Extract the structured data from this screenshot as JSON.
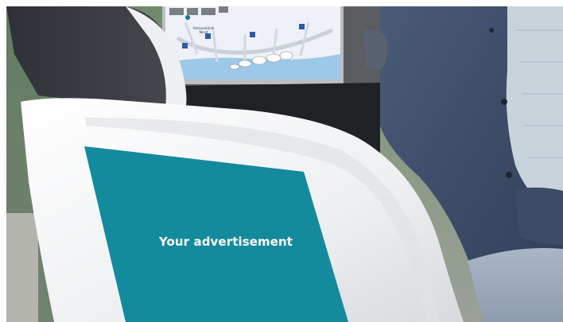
{
  "advertisement": {
    "label": "Your advertisement",
    "panel_color": "#148a9d"
  },
  "map_screen": {
    "stop_label_line1": "Ostseeklinik",
    "stop_label_line2": "Nord"
  },
  "colors": {
    "seat_white": "#eef0f1",
    "jacket_blue": "#3b4c68",
    "shirt_light": "#c8d3dc",
    "map_water": "#9ec8e8",
    "map_land": "#eef1f5",
    "parking_blue": "#2f5aa6"
  }
}
